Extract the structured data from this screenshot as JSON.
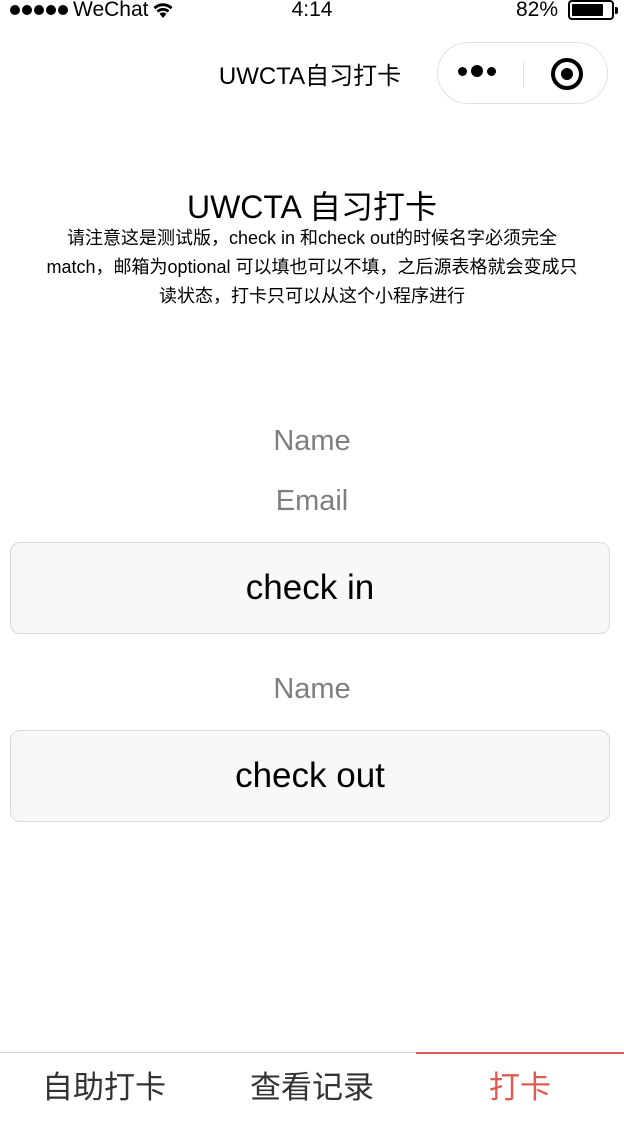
{
  "status_bar": {
    "carrier": "WeChat",
    "time": "4:14",
    "battery_percent": "82%",
    "battery_level": 0.82
  },
  "nav": {
    "title": "UWCTA自习打卡"
  },
  "header": {
    "title": "UWCTA 自习打卡",
    "notice": "请注意这是测试版，check in 和check out的时候名字必须完全match，邮箱为optional 可以填也可以不填，之后源表格就会变成只读状态，打卡只可以从这个小程序进行"
  },
  "checkin_form": {
    "name_placeholder": "Name",
    "email_placeholder": "Email",
    "button_label": "check in"
  },
  "checkout_form": {
    "name_placeholder": "Name",
    "button_label": "check out"
  },
  "tabbar": {
    "items": [
      {
        "label": "自助打卡",
        "active": false
      },
      {
        "label": "查看记录",
        "active": false
      },
      {
        "label": "打卡",
        "active": true
      }
    ],
    "active_color": "#e05a54"
  }
}
